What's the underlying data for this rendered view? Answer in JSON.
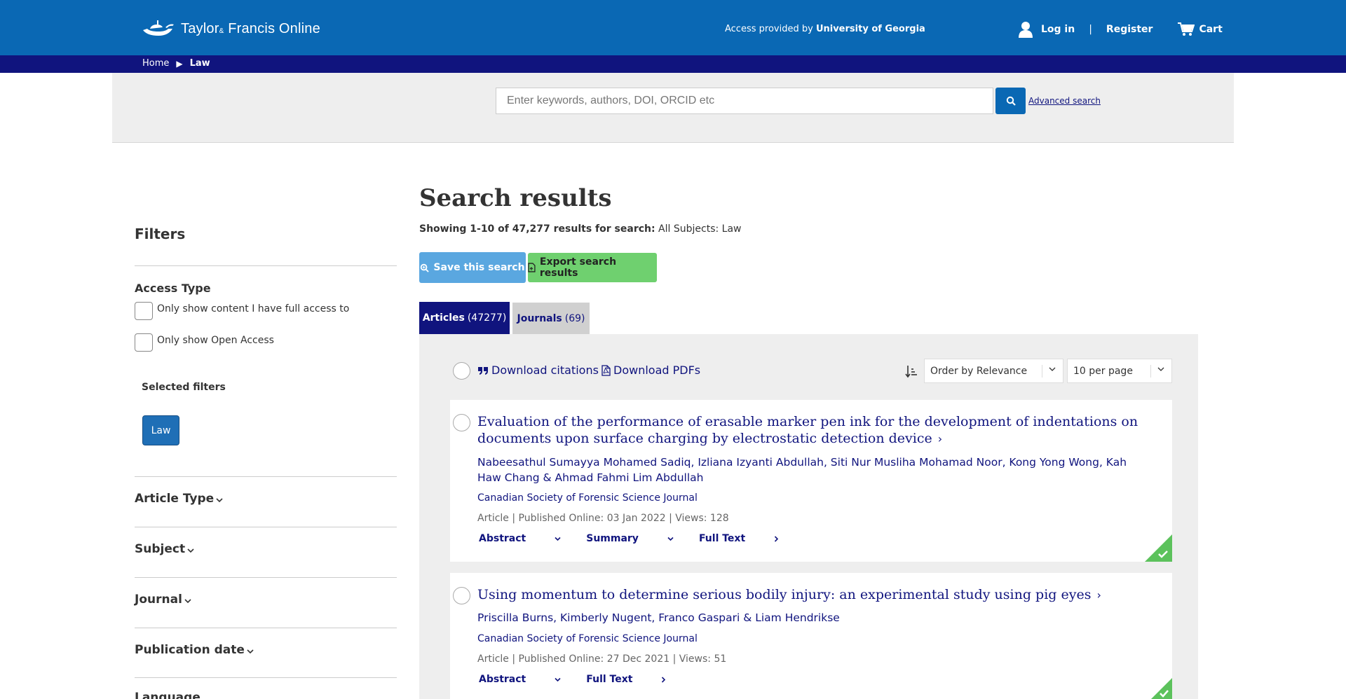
{
  "header": {
    "logo_text": "Taylor",
    "logo_amp": "&",
    "logo_text2": "Francis Online",
    "access_prefix": "Access provided by",
    "access_institution": "University of Georgia",
    "login": "Log in",
    "separator": "|",
    "register": "Register",
    "cart": "Cart"
  },
  "breadcrumb": {
    "home": "Home",
    "current": "Law"
  },
  "search": {
    "placeholder": "Enter keywords, authors, DOI, ORCID etc",
    "advanced": "Advanced search"
  },
  "filters": {
    "title": "Filters",
    "access_type": "Access Type",
    "full_access": "Only show content I have full access to",
    "open_access": "Only show Open Access",
    "selected_title": "Selected filters",
    "selected_tag": "Law",
    "facets": [
      "Article Type",
      "Subject",
      "Journal",
      "Publication date",
      "Language"
    ]
  },
  "main": {
    "title": "Search results",
    "showing_bold": "Showing 1-10 of 47,277 results for search:",
    "showing_rest": "All Subjects: Law",
    "save_search": "Save this search",
    "export": "Export search results",
    "tab_articles": "Articles",
    "tab_articles_count": "(47277)",
    "tab_journals": "Journals",
    "tab_journals_count": "(69)",
    "download_citations": "Download citations",
    "download_pdfs": "Download PDFs",
    "order_by": "Order by Relevance",
    "per_page": "10 per page"
  },
  "results": [
    {
      "title": "Evaluation of the performance of erasable marker pen ink for the development of indentations on documents upon surface charging by electrostatic detection device",
      "authors": "Nabeesathul Sumayya Mohamed Sadiq, Izliana Izyanti Abdullah, Siti Nur Musliha Mohamad Noor, Kong Yong Wong, Kah Haw Chang & Ahmad Fahmi Lim Abdullah",
      "journal": "Canadian Society of Forensic Science Journal",
      "meta": "Article | Published Online: 03 Jan 2022 | Views: 128",
      "abstract": "Abstract",
      "summary": "Summary",
      "fulltext": "Full Text"
    },
    {
      "title": "Using momentum to determine serious bodily injury: an experimental study using pig eyes",
      "authors": "Priscilla Burns, Kimberly Nugent, Franco Gaspari & Liam Hendrikse",
      "journal": "Canadian Society of Forensic Science Journal",
      "meta": "Article | Published Online: 27 Dec 2021 | Views: 51",
      "abstract": "Abstract",
      "fulltext": "Full Text"
    }
  ],
  "colors": {
    "header_blue": "#0a68b4",
    "navy": "#10147e",
    "save_button": "#5aa7e0",
    "export_button": "#6fd06f",
    "access_check": "#5cc25c"
  }
}
